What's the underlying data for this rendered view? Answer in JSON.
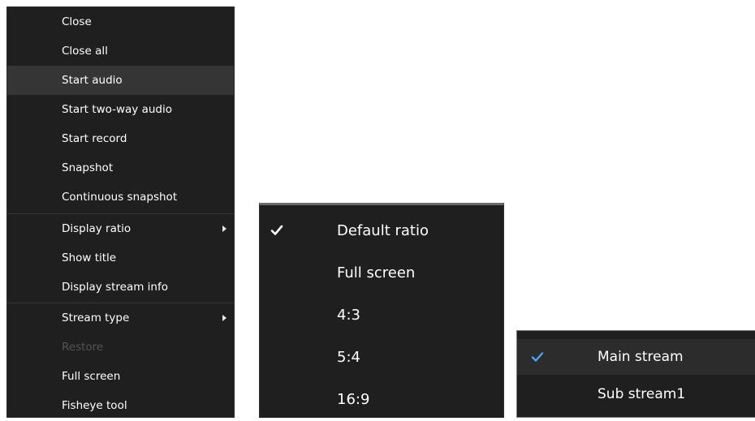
{
  "main_menu": {
    "items": [
      {
        "label": "Close"
      },
      {
        "label": "Close all"
      },
      {
        "label": "Start audio"
      },
      {
        "label": "Start two-way audio"
      },
      {
        "label": "Start record"
      },
      {
        "label": "Snapshot"
      },
      {
        "label": "Continuous snapshot"
      },
      {
        "label": "Display ratio"
      },
      {
        "label": "Show title"
      },
      {
        "label": "Display stream info"
      },
      {
        "label": "Stream type"
      },
      {
        "label": "Restore"
      },
      {
        "label": "Full screen"
      },
      {
        "label": "Fisheye tool"
      }
    ],
    "highlighted_item": "Start audio",
    "disabled_item": "Restore"
  },
  "ratio_menu": {
    "items": [
      {
        "label": "Default ratio"
      },
      {
        "label": "Full screen"
      },
      {
        "label": "4:3"
      },
      {
        "label": "5:4"
      },
      {
        "label": "16:9"
      }
    ],
    "checked_item": "Default ratio"
  },
  "stream_menu": {
    "items": [
      {
        "label": "Main stream"
      },
      {
        "label": "Sub stream1"
      }
    ],
    "checked_item": "Main stream"
  },
  "colors": {
    "menu_background": "#1f1f1f",
    "highlight": "#353535",
    "disabled_text": "#555555",
    "check_accent": "#4aa3ff"
  },
  "icons": {
    "submenu_arrow": "chevron-right-icon",
    "ratio_check": "checkmark-icon",
    "stream_check": "checkmark-icon"
  }
}
